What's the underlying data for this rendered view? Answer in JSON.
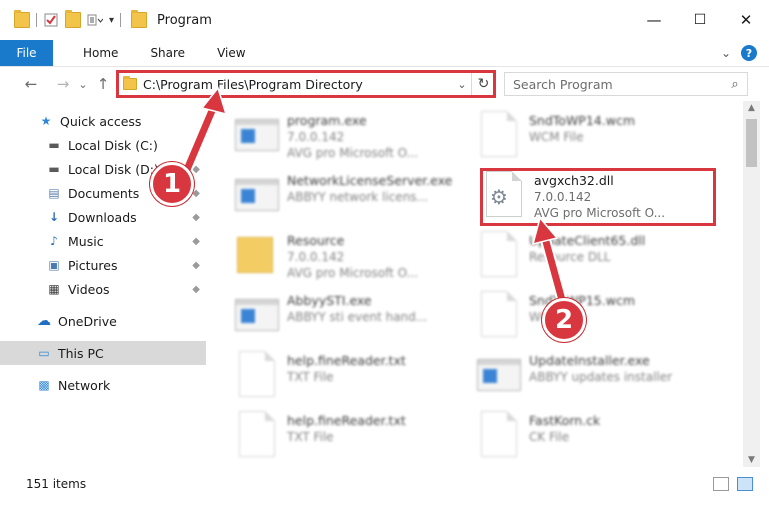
{
  "window": {
    "title": "Program",
    "minimize": "—",
    "maximize": "☐",
    "close": "✕"
  },
  "ribbon": {
    "tabs": [
      "File",
      "Home",
      "Share",
      "View"
    ],
    "expand_glyph": "⌄",
    "help_glyph": "?"
  },
  "address": {
    "back": "←",
    "forward": "→",
    "recent": "⌄",
    "up": "↑",
    "path": "C:\\Program Files\\Program Directory",
    "dropdown": "⌄",
    "refresh": "↻"
  },
  "search": {
    "placeholder": "Search Program",
    "icon": "⌕"
  },
  "sidebar": {
    "items": [
      {
        "label": "Quick access",
        "icon": "star-icon",
        "glyph": "★",
        "color": "#2f87d8",
        "pinned": false
      },
      {
        "label": "Local Disk (C:)",
        "icon": "drive-icon",
        "glyph": "▬",
        "color": "#5a5a5a",
        "pinned": true
      },
      {
        "label": "Local Disk (D:)",
        "icon": "drive-icon",
        "glyph": "▬",
        "color": "#5a5a5a",
        "pinned": true
      },
      {
        "label": "Documents",
        "icon": "documents-icon",
        "glyph": "▤",
        "color": "#5a7fa8",
        "pinned": true
      },
      {
        "label": "Downloads",
        "icon": "downloads-icon",
        "glyph": "↓",
        "color": "#2f6fb5",
        "pinned": true
      },
      {
        "label": "Music",
        "icon": "music-icon",
        "glyph": "♪",
        "color": "#2f6fb5",
        "pinned": true
      },
      {
        "label": "Pictures",
        "icon": "pictures-icon",
        "glyph": "▣",
        "color": "#4a7bb0",
        "pinned": true
      },
      {
        "label": "Videos",
        "icon": "videos-icon",
        "glyph": "▦",
        "color": "#3d3d3d",
        "pinned": true
      },
      {
        "label": "OneDrive",
        "icon": "onedrive-icon",
        "glyph": "☁",
        "color": "#1f6fc4",
        "pinned": false
      },
      {
        "label": "This PC",
        "icon": "pc-icon",
        "glyph": "▭",
        "color": "#2f87d8",
        "pinned": false
      },
      {
        "label": "Network",
        "icon": "network-icon",
        "glyph": "▩",
        "color": "#2f87d8",
        "pinned": false
      }
    ],
    "pin_glyph": "📌"
  },
  "files": [
    {
      "name": "program.exe",
      "line2": "7.0.0.142",
      "line3": "AVG pro Microsoft O...",
      "type": "exe",
      "blurred": true
    },
    {
      "name": "SndToWP14.wcm",
      "line2": "WCM File",
      "line3": "",
      "type": "doc",
      "blurred": true
    },
    {
      "name": "NetworkLicenseServer.exe",
      "line2": "ABBYY network licens...",
      "line3": "",
      "type": "exe",
      "blurred": true
    },
    {
      "name": "avgxch32.dll",
      "line2": "7.0.0.142",
      "line3": "AVG pro Microsoft O...",
      "type": "dll",
      "blurred": false
    },
    {
      "name": "Resource",
      "line2": "7.0.0.142",
      "line3": "AVG pro Microsoft O...",
      "type": "folder",
      "blurred": true
    },
    {
      "name": "UpdateClient65.dll",
      "line2": "Resource DLL",
      "line3": "",
      "type": "doc",
      "blurred": true
    },
    {
      "name": "AbbyySTI.exe",
      "line2": "ABBYY sti event hand...",
      "line3": "",
      "type": "exe",
      "blurred": true
    },
    {
      "name": "SndToWP15.wcm",
      "line2": "WCM File",
      "line3": "",
      "type": "doc",
      "blurred": true
    },
    {
      "name": "help.fineReader.txt",
      "line2": "TXT File",
      "line3": "",
      "type": "doc",
      "blurred": true
    },
    {
      "name": "UpdateInstaller.exe",
      "line2": "ABBYY updates installer",
      "line3": "",
      "type": "exe",
      "blurred": true
    },
    {
      "name": "help.fineReader.txt",
      "line2": "TXT File",
      "line3": "",
      "type": "doc",
      "blurred": true
    },
    {
      "name": "FastKorn.ck",
      "line2": "CK File",
      "line3": "",
      "type": "doc",
      "blurred": true
    }
  ],
  "status": {
    "item_count": "151 items"
  },
  "annotations": {
    "step1": "1",
    "step2": "2",
    "color": "#d8373f"
  }
}
